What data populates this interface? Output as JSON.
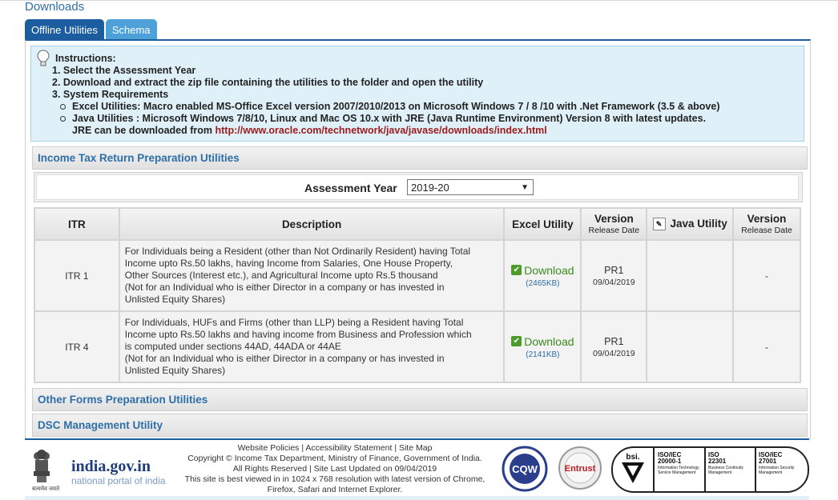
{
  "page": {
    "title": "Downloads"
  },
  "tabs": [
    {
      "label": "Offline Utilities"
    },
    {
      "label": "Schema"
    }
  ],
  "instructions": {
    "heading": "Instructions:",
    "steps": [
      "1. Select the Assessment Year",
      "2. Download and extract the zip file containing the utilities to the folder and open the utility",
      "3. System Requirements"
    ],
    "req_excel": "Excel Utilities:  Macro enabled MS-Office Excel version 2007/2010/2013 on Microsoft Windows 7 / 8 /10 with .Net Framework (3.5 & above)",
    "req_java": "Java Utilities :  Microsoft Windows 7/8/10, Linux and Mac OS 10.x with JRE (Java Runtime Environment) Version 8 with latest updates.",
    "jre_text": "JRE can be downloaded from ",
    "jre_link": "http://www.oracle.com/technetwork/java/javase/downloads/index.html"
  },
  "sections": {
    "income_tax": "Income Tax Return Preparation Utilities",
    "other_forms": "Other Forms Preparation Utilities",
    "dsc": "DSC Management Utility"
  },
  "assessment": {
    "label": "Assessment Year",
    "selected": "2019-20"
  },
  "table": {
    "headers": {
      "itr": "ITR",
      "description": "Description",
      "excel": "Excel Utility",
      "version": "Version",
      "release_date": "Release Date",
      "java": "Java Utility"
    },
    "rows": [
      {
        "itr": "ITR 1",
        "description": [
          "For Individuals being a Resident (other than Not Ordinarily Resident) having Total",
          "Income upto Rs.50 lakhs, having Income from Salaries, One House Property,",
          "Other Sources (Interest etc.), and Agricultural Income upto Rs.5 thousand",
          "(Not for an Individual who is either Director in a company or has invested in",
          "Unlisted Equity Shares)"
        ],
        "download_label": "Download",
        "size": "(2465KB)",
        "version": "PR1",
        "date": "09/04/2019",
        "java_version": "-"
      },
      {
        "itr": "ITR 4",
        "description": [
          "For Individuals, HUFs and Firms (other than LLP) being a Resident having Total",
          "Income upto Rs.50 lakhs and having income from Business and Profession which",
          "is computed under sections 44AD, 44ADA or 44AE",
          "(Not for an Individual who is either Director in a company or has invested in",
          "Unlisted Equity Shares)"
        ],
        "download_label": "Download",
        "size": "(2141KB)",
        "version": "PR1",
        "date": "09/04/2019",
        "java_version": "-"
      }
    ]
  },
  "footer": {
    "link_policies": "Website Policies",
    "link_accessibility": "Accessibility Statement",
    "link_sitemap": "Site Map",
    "separator": "|",
    "copyright": "Copyright © Income Tax Department, Ministry of Finance, Government of India.",
    "rights": "All Rights Reserved | Site Last Updated on 09/04/2019",
    "best_view_1": "This site is best viewed in in 1024 x 768 resolution with latest version of Chrome,",
    "best_view_2": "Firefox, Safari and Internet Explorer.",
    "india_logo": "india.gov.in",
    "india_sub": "national portal of india",
    "emblem_caption": "सत्यमेव जयते",
    "badge_cqw": "CQW",
    "badge_entrust": "Entrust",
    "bsi": "bsi.",
    "cert1_title": "ISO/IEC",
    "cert1_num": "20000-1",
    "cert1_desc": "Information Technology Service Management",
    "cert2_title": "ISO",
    "cert2_num": "22301",
    "cert2_desc": "Business Continuity Management",
    "cert3_title": "ISO/IEC",
    "cert3_num": "27001",
    "cert3_desc": "Information Security Management"
  },
  "colors": {
    "tab_active": "#1b5d9f",
    "tab_inactive": "#4da1d8",
    "section_text": "#2f6fa7",
    "download_green": "#3a8a1e",
    "link_red": "#9c1b1b"
  }
}
